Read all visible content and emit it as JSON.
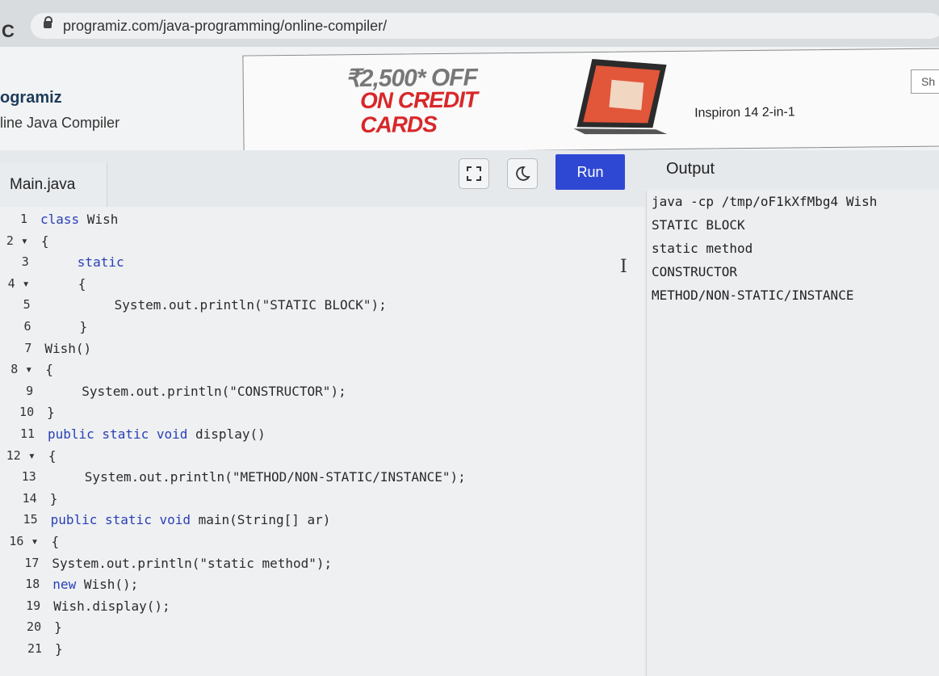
{
  "browser": {
    "url": "programiz.com/java-programming/online-compiler/"
  },
  "header": {
    "brand": "ogramiz",
    "subtitle": "line Java Compiler",
    "share_label": "Sh"
  },
  "ad": {
    "offer": "₹2,500* OFF",
    "offer_line2": "ON CREDIT CARDS",
    "product": "Inspiron 14 2-in-1"
  },
  "editor": {
    "filename": "Main.java",
    "run_label": "Run",
    "lines": [
      {
        "n": "1",
        "fold": "",
        "indent": 0,
        "kw": "class",
        "text": " Wish"
      },
      {
        "n": "2",
        "fold": "▾",
        "indent": 0,
        "kw": "",
        "text": "{"
      },
      {
        "n": "3",
        "fold": "",
        "indent": 4,
        "kw": "static",
        "text": ""
      },
      {
        "n": "4",
        "fold": "▾",
        "indent": 4,
        "kw": "",
        "text": "{"
      },
      {
        "n": "5",
        "fold": "",
        "indent": 8,
        "kw": "",
        "text": "System.out.println(\"STATIC BLOCK\");"
      },
      {
        "n": "6",
        "fold": "",
        "indent": 4,
        "kw": "",
        "text": "}"
      },
      {
        "n": "7",
        "fold": "",
        "indent": 0,
        "kw": "",
        "text": "Wish()"
      },
      {
        "n": "8",
        "fold": "▾",
        "indent": 0,
        "kw": "",
        "text": "{"
      },
      {
        "n": "9",
        "fold": "",
        "indent": 4,
        "kw": "",
        "text": "System.out.println(\"CONSTRUCTOR\");"
      },
      {
        "n": "10",
        "fold": "",
        "indent": 0,
        "kw": "",
        "text": "}"
      },
      {
        "n": "11",
        "fold": "",
        "indent": 0,
        "kw": "public static void",
        "text": " display()"
      },
      {
        "n": "12",
        "fold": "▾",
        "indent": 0,
        "kw": "",
        "text": "{"
      },
      {
        "n": "13",
        "fold": "",
        "indent": 4,
        "kw": "",
        "text": "System.out.println(\"METHOD/NON-STATIC/INSTANCE\");"
      },
      {
        "n": "14",
        "fold": "",
        "indent": 0,
        "kw": "",
        "text": "}"
      },
      {
        "n": "15",
        "fold": "",
        "indent": 0,
        "kw": "public static void",
        "text": " main(String[] ar)"
      },
      {
        "n": "16",
        "fold": "▾",
        "indent": 0,
        "kw": "",
        "text": "{"
      },
      {
        "n": "17",
        "fold": "",
        "indent": 0,
        "kw": "",
        "text": "System.out.println(\"static method\");"
      },
      {
        "n": "18",
        "fold": "",
        "indent": 0,
        "kw": "new",
        "text": " Wish();"
      },
      {
        "n": "19",
        "fold": "",
        "indent": 0,
        "kw": "",
        "text": "Wish.display();"
      },
      {
        "n": "20",
        "fold": "",
        "indent": 0,
        "kw": "",
        "text": "}"
      },
      {
        "n": "21",
        "fold": "",
        "indent": 0,
        "kw": "",
        "text": "}"
      }
    ]
  },
  "output": {
    "title": "Output",
    "lines": [
      "java -cp /tmp/oF1kXfMbg4 Wish",
      "STATIC BLOCK",
      "static method",
      "CONSTRUCTOR",
      "METHOD/NON-STATIC/INSTANCE"
    ]
  },
  "colors": {
    "run_button": "#2f48d4",
    "keyword": "#2a3fb5",
    "ad_red": "#d8282a"
  }
}
